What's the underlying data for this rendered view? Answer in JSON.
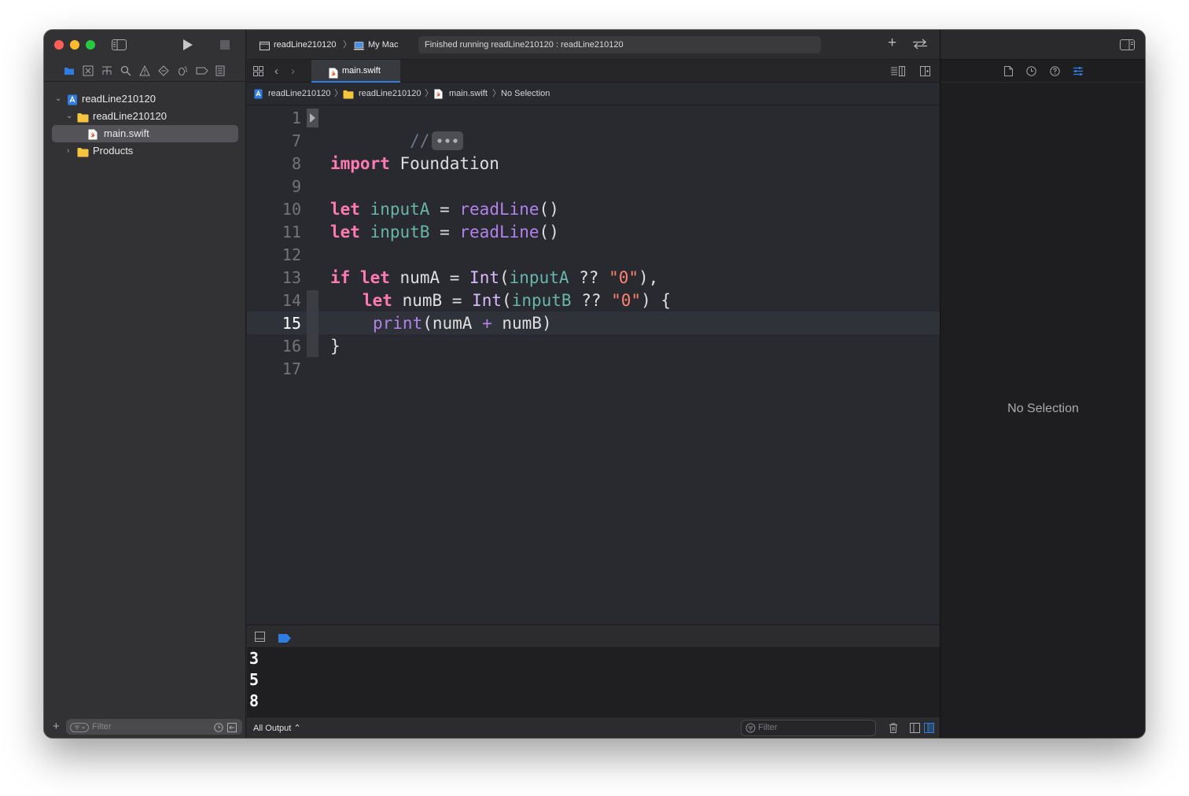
{
  "window": {
    "traffic_lights": [
      "close",
      "minimize",
      "zoom"
    ]
  },
  "toolbar": {
    "scheme_name": "readLine210120",
    "destination": "My Mac",
    "activity_status": "Finished running readLine210120 : readLine210120"
  },
  "navigator": {
    "tabs": [
      "project-navigator",
      "source-control-navigator",
      "symbol-navigator",
      "find-navigator",
      "issue-navigator",
      "test-navigator",
      "debug-navigator",
      "breakpoint-navigator",
      "report-navigator"
    ],
    "active_tab": "project-navigator",
    "tree": [
      {
        "label": "readLine210120",
        "type": "project",
        "expanded": true
      },
      {
        "label": "readLine210120",
        "type": "folder",
        "expanded": true
      },
      {
        "label": "main.swift",
        "type": "swift-file",
        "selected": true
      },
      {
        "label": "Products",
        "type": "folder",
        "expanded": false
      }
    ],
    "filter_placeholder": "Filter"
  },
  "editor": {
    "tab_label": "main.swift",
    "jump_bar": [
      "readLine210120",
      "readLine210120",
      "main.swift",
      "No Selection"
    ],
    "line_numbers": [
      "1",
      "7",
      "8",
      "9",
      "10",
      "11",
      "12",
      "13",
      "14",
      "15",
      "16",
      "17"
    ],
    "current_line": "15",
    "folded_comment": "//",
    "code": {
      "l8_kw": "import",
      "l8_rest": " Foundation",
      "let": "let",
      "input_a": "inputA",
      "input_b": "inputB",
      "eq": " = ",
      "read_line": "readLine",
      "parens": "()",
      "if": "if",
      "num_a": " numA = ",
      "num_b": " numB = ",
      "int": "Int",
      "open_paren": "(",
      "coalesce": " ?? ",
      "zero_str": "\"0\"",
      "close_comma": "),",
      "close_brace_open": ") {",
      "print": "print",
      "print_args_a": "(numA ",
      "plus": "+",
      "print_args_b": " numB)",
      "close_brace": "}"
    }
  },
  "console": {
    "output": [
      "3",
      "5",
      "8"
    ],
    "output_selector": "All Output ⌃",
    "filter_placeholder": "Filter"
  },
  "inspector": {
    "tabs": [
      "file-inspector",
      "history-inspector",
      "quick-help-inspector",
      "attributes-inspector"
    ],
    "active_tab": "attributes-inspector",
    "empty_message": "No Selection"
  },
  "colors": {
    "keyword": "#ff7ab2",
    "type": "#dabaff",
    "function": "#b281eb",
    "variable": "#67b7a4",
    "string": "#ff8170",
    "accent": "#2f7de1",
    "editor_background": "#292a30"
  }
}
